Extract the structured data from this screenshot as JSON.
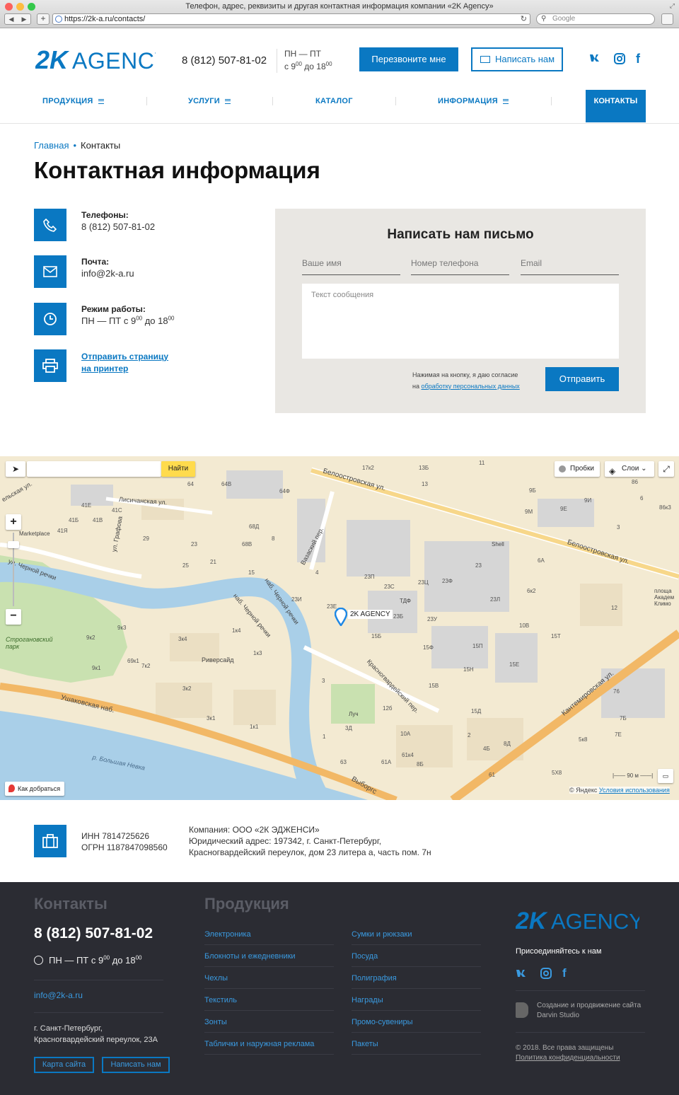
{
  "browser": {
    "title": "Телефон, адрес, реквизиты и другая контактная информация компании «2K Agency»",
    "url": "https://2k-a.ru/contacts/",
    "search_placeholder": "Google"
  },
  "header": {
    "logo_text": "2K AGENCY",
    "phone": "8 (812) 507-81-02",
    "hours_days": "ПН — ПТ",
    "hours_from_prefix": "с 9",
    "hours_from_sup": "00",
    "hours_to_prefix": " до 18",
    "hours_to_sup": "00",
    "call_button": "Перезвоните мне",
    "write_button": "Написать нам",
    "social": {
      "vk": "vk",
      "instagram": "instagram-icon",
      "facebook": "f"
    }
  },
  "nav": {
    "items": [
      {
        "label": "ПРОДУКЦИЯ",
        "has_menu": true
      },
      {
        "label": "УСЛУГИ",
        "has_menu": true
      },
      {
        "label": "КАТАЛОГ",
        "has_menu": false
      },
      {
        "label": "ИНФОРМАЦИЯ",
        "has_menu": true
      }
    ],
    "active": "КОНТАКТЫ"
  },
  "breadcrumb": {
    "home": "Главная",
    "current": "Контакты"
  },
  "page_title": "Контактная информация",
  "contacts": {
    "phones_label": "Телефоны:",
    "phones_value": "8 (812) 507-81-02",
    "mail_label": "Почта:",
    "mail_value": "info@2k-a.ru",
    "hours_label": "Режим работы:",
    "hours_prefix": "ПН — ПТ с 9",
    "hours_sup1": "00",
    "hours_mid": " до 18",
    "hours_sup2": "00",
    "print_line1": "Отправить страницу",
    "print_line2": "на принтер"
  },
  "form": {
    "title": "Написать нам письмо",
    "name_placeholder": "Ваше имя",
    "phone_placeholder": "Номер телефона",
    "email_placeholder": "Email",
    "message_placeholder": "Текст сообщения",
    "agree_text": "Нажимая на кнопку, я даю согласие",
    "agree_prefix": "на ",
    "agree_link": "обработку персональных данных",
    "submit": "Отправить"
  },
  "map": {
    "search_button": "Найти",
    "traffic": "Пробки",
    "layers": "Слои",
    "route": "Как добраться",
    "marker_label": "2K AGENCY",
    "scale": "90 м",
    "copyright": "© Яндекс",
    "terms": "Условия использования",
    "labels": {
      "street_beloostrov": "Белоостровская ул.",
      "street_beloostrov2": "Белоостровская ул.",
      "street_lisich": "Лисичанская ул.",
      "street_grafova": "ул. Графова",
      "street_chernaya": "ул. Черной речки",
      "embank_chernaya": "наб. Черной речки",
      "embank_chernaya2": "наб. Черной речки",
      "street_vazaski": "Вазаский пер.",
      "street_krasnogv": "Красногвардейский пер.",
      "street_kantemir": "Кантемировская ул.",
      "street_ushakov": "Ушаковская наб.",
      "river_nevka": "р. Большая Невка",
      "park": "Строгановский парк",
      "riversaid": "Риверсайд",
      "marketplace": "Marketplace",
      "shell": "Shell",
      "tdf": "ТДФ",
      "luch": "Луч",
      "vyborg": "Выборгс",
      "akadem": "площа Академ Климо",
      "street_gelsk": "ельская ул."
    },
    "numbers": [
      "17к2",
      "13Б",
      "11",
      "13",
      "64",
      "64В",
      "64Ф",
      "41Е",
      "41С",
      "41Б",
      "41В",
      "41Я",
      "29",
      "23",
      "25",
      "21",
      "68Д",
      "68В",
      "8",
      "15",
      "4",
      "23П",
      "23С",
      "23Ц",
      "23Ф",
      "23",
      "23Л",
      "23И",
      "23Е",
      "23Б",
      "23У",
      "15Б",
      "15Ф",
      "15П",
      "15Н",
      "15Е",
      "15В",
      "15Д",
      "12б",
      "10А",
      "61А",
      "61к4",
      "8Б",
      "63",
      "3Д",
      "3",
      "1",
      "9к3",
      "9к2",
      "9к1",
      "69к1",
      "7к2",
      "1к4",
      "1к3",
      "3к4",
      "3к2",
      "3к1",
      "1к1",
      "9Б",
      "9М",
      "9Е",
      "9И",
      "6А",
      "6к2",
      "12",
      "10В",
      "15Т",
      "5к8",
      "5Х8",
      "4Б",
      "8Д",
      "7Б",
      "7Е",
      "76",
      "86",
      "86к3",
      "6",
      "3",
      "2",
      "61"
    ]
  },
  "legal": {
    "inn": "ИНН 7814725626",
    "ogrn": "ОГРН 1187847098560",
    "company": "Компания: ООО «2К ЭДЖЕНСИ»",
    "address1": "Юридический адрес: 197342, г. Санкт-Петербург,",
    "address2": "Красногвардейский переулок, дом 23 литера а, часть пом. 7н"
  },
  "footer": {
    "contacts_title": "Контакты",
    "phone": "8 (812) 507-81-02",
    "hours_prefix": "ПН — ПТ с 9",
    "hours_sup1": "00",
    "hours_mid": " до 18",
    "hours_sup2": "00",
    "email": "info@2k-a.ru",
    "address1": "г. Санкт-Петербург,",
    "address2": "Красногвардейский переулок, 23А",
    "map_button": "Карта сайта",
    "write_button": "Написать нам",
    "products_title": "Продукция",
    "products_col1": [
      "Электроника",
      "Блокноты и ежедневники",
      "Чехлы",
      "Текстиль",
      "Зонты",
      "Таблички и наружная реклама"
    ],
    "products_col2": [
      "Сумки и рюкзаки",
      "Посуда",
      "Полиграфия",
      "Награды",
      "Промо-сувениры",
      "Пакеты"
    ],
    "logo_text": "2K AGENCY",
    "join": "Присоединяйтесь к нам",
    "studio1": "Создание и продвижение сайта",
    "studio2": "Darvin Studio",
    "copyright": "© 2018. Все права защищены",
    "privacy": "Политика конфиденциальности"
  },
  "colors": {
    "accent": "#0a78c2",
    "footer_bg": "#2b2c33",
    "form_bg": "#e9e7e3"
  }
}
